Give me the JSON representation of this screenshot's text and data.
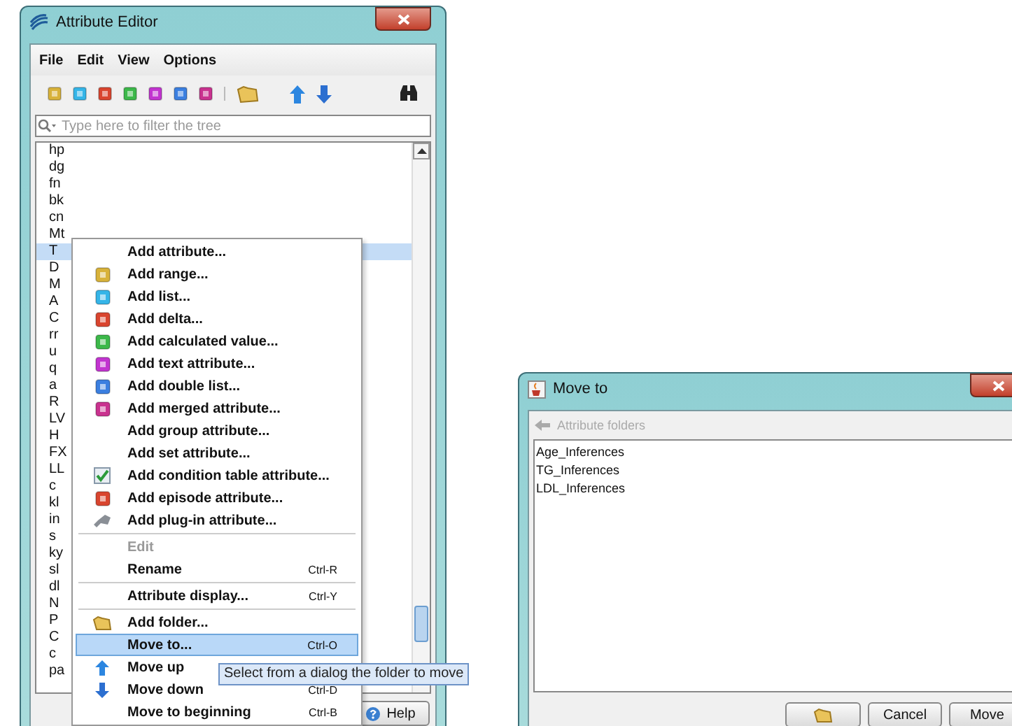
{
  "editor": {
    "title": "Attribute Editor",
    "menu": [
      "File",
      "Edit",
      "View",
      "Options"
    ],
    "filter": {
      "placeholder": "Type here to filter the tree"
    },
    "tree": [
      {
        "label": "hp",
        "selected": false
      },
      {
        "label": "dg",
        "selected": false
      },
      {
        "label": "fn",
        "selected": false
      },
      {
        "label": "bk",
        "selected": false
      },
      {
        "label": "cn",
        "selected": false
      },
      {
        "label": "Mt",
        "selected": false
      },
      {
        "label": "T",
        "selected": true
      },
      {
        "label": "D",
        "selected": false
      },
      {
        "label": "M",
        "selected": false
      },
      {
        "label": "A",
        "selected": false
      },
      {
        "label": "C",
        "selected": false
      },
      {
        "label": "rr",
        "selected": false
      },
      {
        "label": "u",
        "selected": false
      },
      {
        "label": "q",
        "selected": false
      },
      {
        "label": "a",
        "selected": false
      },
      {
        "label": "R",
        "selected": false
      },
      {
        "label": "LV",
        "selected": false
      },
      {
        "label": "H",
        "selected": false
      },
      {
        "label": "FX",
        "selected": false
      },
      {
        "label": "LL",
        "selected": false
      },
      {
        "label": "c",
        "selected": false
      },
      {
        "label": "kl",
        "selected": false
      },
      {
        "label": "in",
        "selected": false
      },
      {
        "label": "s",
        "selected": false
      },
      {
        "label": "ky",
        "selected": false
      },
      {
        "label": "sl",
        "selected": false
      },
      {
        "label": "dl",
        "selected": false
      },
      {
        "label": "N",
        "selected": false
      },
      {
        "label": "P",
        "selected": false
      },
      {
        "label": "C",
        "selected": false
      },
      {
        "label": "c",
        "selected": false
      },
      {
        "label": "pa",
        "selected": false
      }
    ],
    "help_button": "Help"
  },
  "context_menu": [
    {
      "kind": "item",
      "label": "Add attribute...",
      "disabled": false,
      "selected": false
    },
    {
      "kind": "item",
      "label": "Add range...",
      "disabled": false,
      "selected": false
    },
    {
      "kind": "item",
      "label": "Add list...",
      "disabled": false,
      "selected": false
    },
    {
      "kind": "item",
      "label": "Add delta...",
      "disabled": false,
      "selected": false
    },
    {
      "kind": "item",
      "label": "Add calculated value...",
      "disabled": false,
      "selected": false
    },
    {
      "kind": "item",
      "label": "Add text attribute...",
      "disabled": false,
      "selected": false
    },
    {
      "kind": "item",
      "label": "Add double list...",
      "disabled": false,
      "selected": false
    },
    {
      "kind": "item",
      "label": "Add merged attribute...",
      "disabled": false,
      "selected": false
    },
    {
      "kind": "item",
      "label": "Add group attribute...",
      "disabled": false,
      "selected": false
    },
    {
      "kind": "item",
      "label": "Add set attribute...",
      "disabled": false,
      "selected": false
    },
    {
      "kind": "item",
      "label": "Add condition table attribute...",
      "disabled": false,
      "selected": false
    },
    {
      "kind": "item",
      "label": "Add episode attribute...",
      "disabled": false,
      "selected": false
    },
    {
      "kind": "item",
      "label": "Add plug-in attribute...",
      "disabled": false,
      "selected": false
    },
    {
      "kind": "separator"
    },
    {
      "kind": "item",
      "label": "Edit",
      "disabled": true,
      "selected": false
    },
    {
      "kind": "item",
      "label": "Rename",
      "shortcut": "Ctrl-R",
      "disabled": false,
      "selected": false
    },
    {
      "kind": "separator"
    },
    {
      "kind": "item",
      "label": "Attribute display...",
      "shortcut": "Ctrl-Y",
      "disabled": false,
      "selected": false
    },
    {
      "kind": "separator"
    },
    {
      "kind": "item",
      "label": "Add folder...",
      "disabled": false,
      "selected": false
    },
    {
      "kind": "item",
      "label": "Move to...",
      "shortcut": "Ctrl-O",
      "disabled": false,
      "selected": true
    },
    {
      "kind": "item",
      "label": "Move up",
      "disabled": false,
      "selected": false
    },
    {
      "kind": "item",
      "label": "Move down",
      "shortcut": "Ctrl-D",
      "disabled": false,
      "selected": false
    },
    {
      "kind": "item",
      "label": "Move to beginning",
      "shortcut": "Ctrl-B",
      "disabled": false,
      "selected": false
    }
  ],
  "tooltip": "Select from a dialog the folder to move",
  "dialog": {
    "title": "Move to",
    "breadcrumb": "Attribute folders",
    "folders": [
      {
        "label": "Age_Inferences",
        "selected": false
      },
      {
        "label": "TG_Inferences",
        "selected": false
      },
      {
        "label": "LDL_Inferences",
        "selected": false
      }
    ],
    "buttons": [
      "Cancel",
      "Move"
    ]
  }
}
